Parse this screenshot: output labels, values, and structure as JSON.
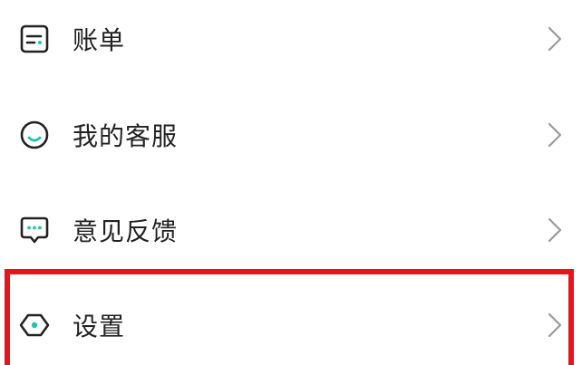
{
  "colors": {
    "icon_stroke": "#222222",
    "accent": "#23c3b0",
    "chevron": "#9a9a9a",
    "highlight": "#e8141c"
  },
  "menu": {
    "items": [
      {
        "label": "账单",
        "icon": "bill-icon"
      },
      {
        "label": "我的客服",
        "icon": "customer-service-icon"
      },
      {
        "label": "意见反馈",
        "icon": "feedback-icon"
      },
      {
        "label": "设置",
        "icon": "settings-icon"
      }
    ]
  }
}
